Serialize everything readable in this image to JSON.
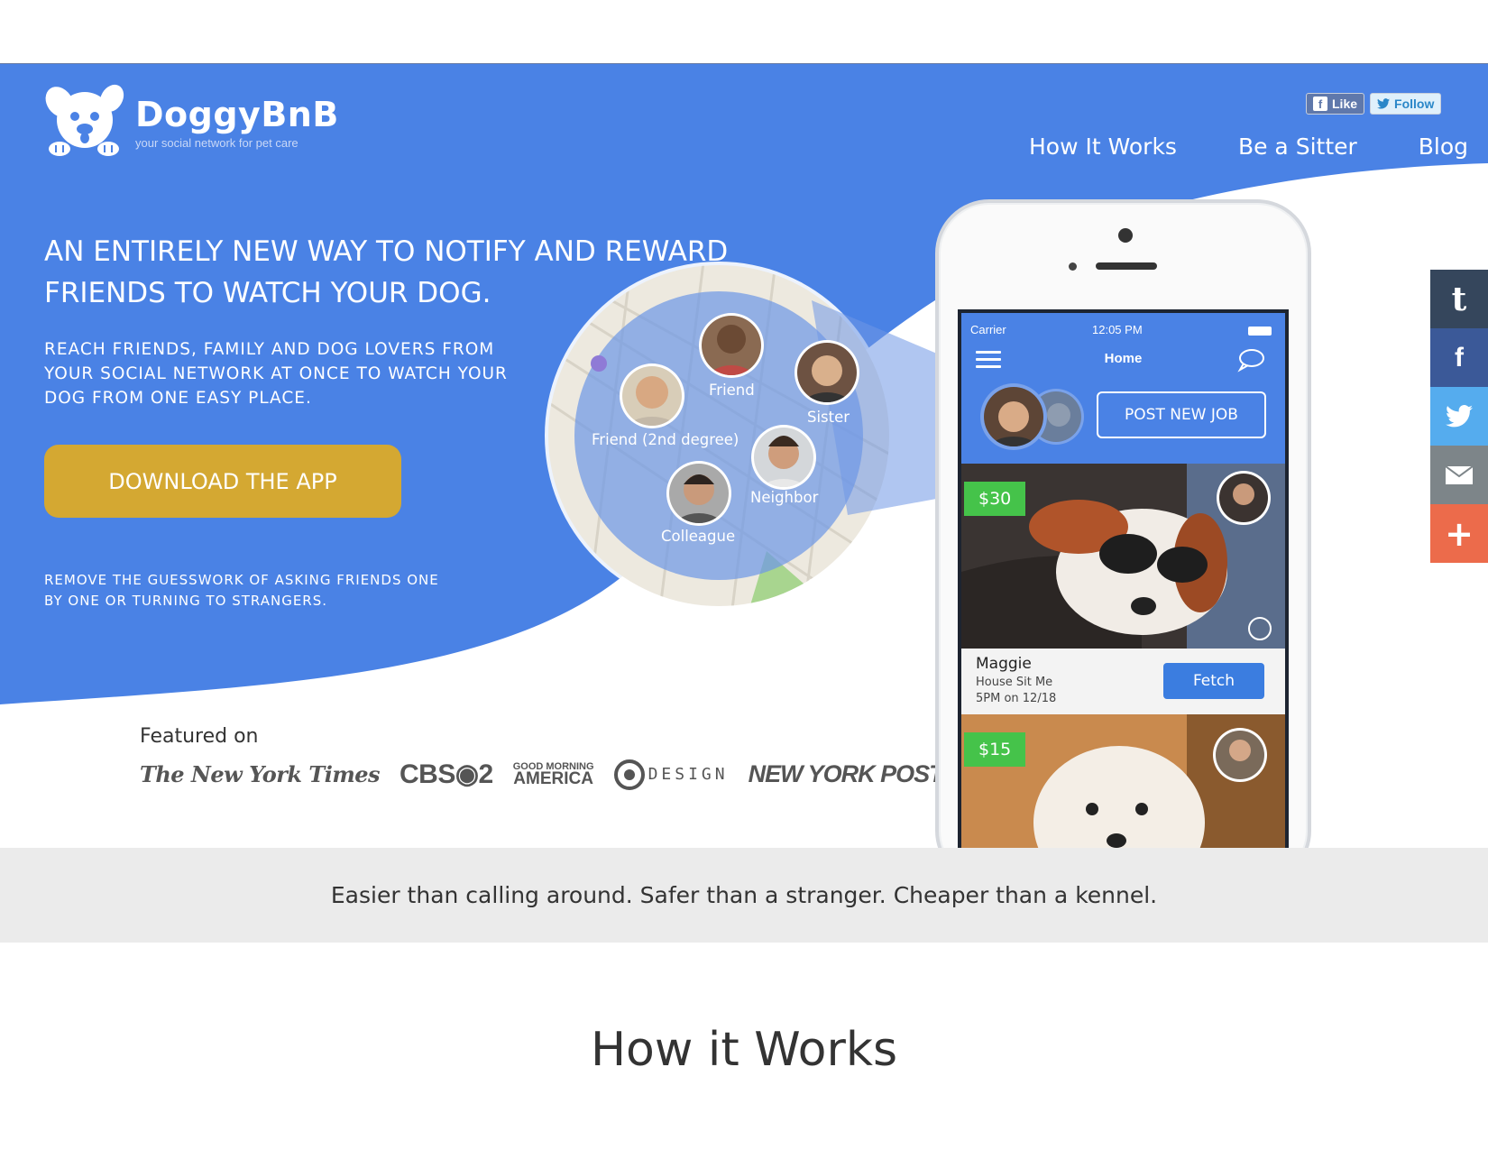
{
  "brand": {
    "name": "DoggyBnB",
    "tagline": "your social network for pet care",
    "primary_color": "#4a82e5",
    "accent_color": "#d4a832"
  },
  "social_small": {
    "like_label": "Like",
    "follow_label": "Follow"
  },
  "nav": {
    "items": [
      {
        "label": "How It Works"
      },
      {
        "label": "Be a Sitter"
      },
      {
        "label": "Blog"
      }
    ]
  },
  "hero": {
    "headline": "AN ENTIRELY NEW WAY TO NOTIFY AND REWARD FRIENDS TO WATCH YOUR DOG.",
    "subline": "REACH FRIENDS, FAMILY AND DOG LOVERS FROM YOUR SOCIAL NETWORK AT ONCE TO WATCH YOUR DOG FROM ONE EASY PLACE.",
    "cta_label": "DOWNLOAD THE APP",
    "footnote": "REMOVE THE GUESSWORK OF ASKING FRIENDS ONE BY ONE OR TURNING TO STRANGERS."
  },
  "map": {
    "labels": {
      "friend": "Friend",
      "sister": "Sister",
      "friend2": "Friend (2nd degree)",
      "neighbor": "Neighbor",
      "colleague": "Colleague"
    }
  },
  "featured": {
    "label": "Featured on",
    "logos": {
      "nyt": "The New York Times",
      "cbs": "CBS",
      "cbs_num": "2",
      "gma_top": "GOOD MORNING",
      "gma_bottom": "AMERICA",
      "codesign": "DESIGN",
      "nypost": "NEW YORK POST"
    }
  },
  "phone": {
    "status": {
      "carrier": "Carrier",
      "time": "12:05 PM"
    },
    "app_title": "Home",
    "post_job_label": "POST NEW JOB",
    "listings": [
      {
        "price": "$30",
        "name": "Maggie",
        "type": "House Sit Me",
        "time": "5PM on 12/18",
        "action": "Fetch"
      },
      {
        "price": "$15"
      }
    ]
  },
  "share_bar": {
    "icons": [
      "tumblr-icon",
      "facebook-icon",
      "twitter-icon",
      "email-icon",
      "plus-icon"
    ],
    "tumblr_glyph": "t",
    "facebook_glyph": "f",
    "plus_glyph": "+"
  },
  "tagline": "Easier than calling around. Safer than a stranger. Cheaper than a kennel.",
  "how_it_works_title": "How it Works"
}
